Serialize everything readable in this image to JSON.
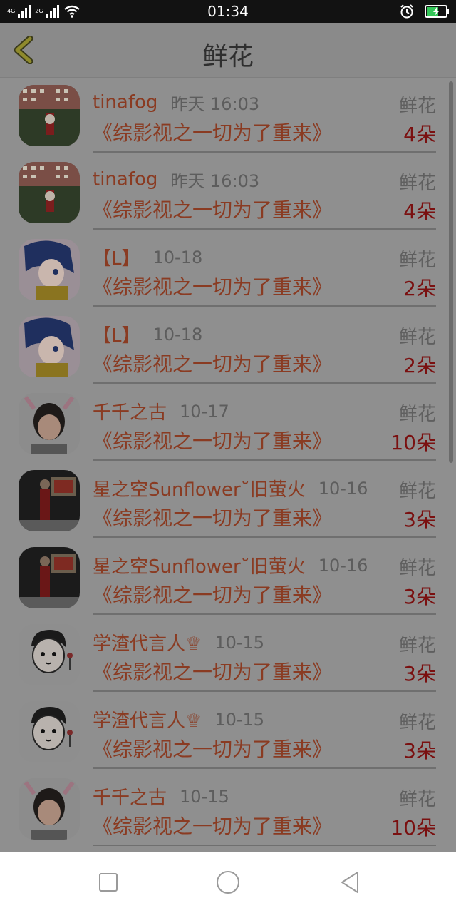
{
  "status_bar": {
    "network_left": "4G",
    "network_right": "2G",
    "time": "01:34"
  },
  "header": {
    "title": "鲜花",
    "back_icon": "chevron-left-icon"
  },
  "items": [
    {
      "username": "tinafog",
      "time": "昨天 16:03",
      "tag": "鲜花",
      "book": "《综影视之一切为了重来》",
      "count": "4朵"
    },
    {
      "username": "tinafog",
      "time": "昨天 16:03",
      "tag": "鲜花",
      "book": "《综影视之一切为了重来》",
      "count": "4朵"
    },
    {
      "username": "【L】",
      "time": "10-18",
      "tag": "鲜花",
      "book": "《综影视之一切为了重来》",
      "count": "2朵"
    },
    {
      "username": "【L】",
      "time": "10-18",
      "tag": "鲜花",
      "book": "《综影视之一切为了重来》",
      "count": "2朵"
    },
    {
      "username": "千千之古",
      "time": "10-17",
      "tag": "鲜花",
      "book": "《综影视之一切为了重来》",
      "count": "10朵"
    },
    {
      "username": "星之空Sunflower˘旧萤火",
      "time": "10-16",
      "tag": "鲜花",
      "book": "《综影视之一切为了重来》",
      "count": "3朵"
    },
    {
      "username": "星之空Sunflower˘旧萤火",
      "time": "10-16",
      "tag": "鲜花",
      "book": "《综影视之一切为了重来》",
      "count": "3朵"
    },
    {
      "username": "学渣代言人♕",
      "time": "10-15",
      "tag": "鲜花",
      "book": "《综影视之一切为了重来》",
      "count": "3朵"
    },
    {
      "username": "学渣代言人♕",
      "time": "10-15",
      "tag": "鲜花",
      "book": "《综影视之一切为了重来》",
      "count": "3朵"
    },
    {
      "username": "千千之古",
      "time": "10-15",
      "tag": "鲜花",
      "book": "《综影视之一切为了重来》",
      "count": "10朵"
    }
  ],
  "colors": {
    "username": "#8a3b22",
    "count": "#7a1010",
    "overlay_bg": "#8f8f8f"
  }
}
